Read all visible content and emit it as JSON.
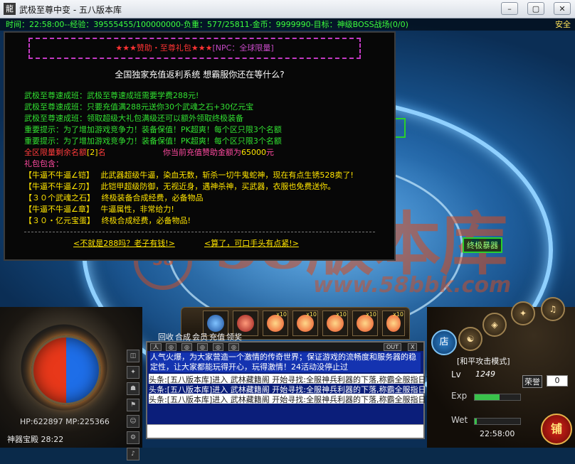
{
  "window": {
    "title": "武极至尊中变 - 五八版本库",
    "icon_name": "app-icon",
    "buttons": [
      "minimize",
      "maximize",
      "close"
    ]
  },
  "hud_top": {
    "status_line": "时间：22:58:00--经验：39555455/100000000-负重：577/25811-金币：9999990-目标：神级BOSS战场(0/0)",
    "safe_zone": "安全"
  },
  "dialog": {
    "banner_red_a": "★★★赞助・至尊礼包★★★",
    "banner_purple": "[NPC：全球限量]",
    "headline": "全国独家充值返利系统 想霸服你还在等什么?",
    "lines": [
      {
        "text": "武极至尊速成班：武极至尊速成班需要学费288元!",
        "color": "green"
      },
      {
        "text": "武极至尊速成班：只要充值满288元送你30个武魂之石+30亿元宝",
        "color": "green"
      },
      {
        "text": "武极至尊速成班：领取超级大礼包满级还可以额外领取终极装备",
        "color": "green"
      },
      {
        "text": "重要提示：为了增加游戏竞争力！装备保值！PK超爽！每个区只限3个名额",
        "color": "green"
      },
      {
        "text": "重要提示：为了增加游戏竞争力！装备保值！PK超爽！每个区只限3个名额",
        "color": "green"
      }
    ],
    "quota_label": "全区限量剩余名额",
    "quota_value": "[2]",
    "quota_unit": "名",
    "sponsor_label": "你当前充值赞助金额为",
    "sponsor_value": "65000",
    "sponsor_unit": "元",
    "gift_heading": "礼包包含：",
    "gifts": [
      {
        "name": "【牛逼不牛逼∠铠】",
        "desc": "此武器超级牛逼，染血无数，斩杀一切牛鬼蛇神，现在有点生锈528卖了!"
      },
      {
        "name": "【牛逼不牛逼∠刃】",
        "desc": "此铠甲超级防御，无视近身，遇神杀神，买武器，衣服也免费送你。"
      },
      {
        "name": "【３０个武魂之石】",
        "desc": "终极装备合成经费，必备物品"
      },
      {
        "name": "【牛逼不牛逼∠章】",
        "desc": "牛逼属性，非常给力!"
      },
      {
        "name": "【３０・亿元宝蛋】",
        "desc": "终极合成经费，必备物品!"
      }
    ],
    "option_left": "<不就是288吗？老子有钱!>",
    "option_right": "<算了，可口手头有点紧!>"
  },
  "scene": {
    "watermark_text": "58版本库",
    "watermark_url": "www.58bbk.com",
    "watermark_logo": "58",
    "map_tag": "终极暴器"
  },
  "hud_bottom": {
    "hp_mp": "HP:622897  MP:225366",
    "map_name": "神器宝殿  28:22",
    "side_icons": [
      "bag-icon",
      "skill-icon",
      "team-icon",
      "guild-icon",
      "friend-icon",
      "setting-icon",
      "sound-icon"
    ],
    "belt_slots": [
      {
        "icon": "rune-skill-icon",
        "color": "#2f72c8",
        "count": ""
      },
      {
        "icon": "flame-skill-icon",
        "color": "#c8322f",
        "count": ""
      },
      {
        "icon": "peach-potion-icon",
        "color": "#ff8a3a",
        "count": "x10"
      },
      {
        "icon": "peach-potion-icon",
        "color": "#ff8a3a",
        "count": "x10"
      },
      {
        "icon": "peach-potion-icon",
        "color": "#ff8a3a",
        "count": "x10"
      },
      {
        "icon": "peach-potion-icon",
        "color": "#ff8a3a",
        "count": "x10"
      },
      {
        "icon": "peach-potion-icon",
        "color": "#ff8a3a",
        "count": "x10"
      }
    ],
    "tabs": [
      "回收",
      "合成",
      "会员",
      "充值",
      "领奖"
    ],
    "chat_controls": [
      "OUT",
      "X"
    ],
    "chat_notice": "人气火爆，为大家营造一个激情的传奇世界；保证游戏的流畅度和服务器的稳定性，让大家都能玩得开心，玩得激情！24活动没停止过",
    "chat_rows": [
      "头条:[五八版本库]进入   武林藏籍阁   开始寻找:全服神兵利器的下落,称霸全服指日可待!",
      "头条:[五八版本库]进入   武林藏籍阁   开始寻找:全服神兵利器的下落,称霸全服指日可待!",
      "头条:[五八版本库]进入   武林藏籍阁   开始寻找:全服神兵利器的下落,称霸全服指日可待!"
    ],
    "mode": "[和平攻击模式]",
    "lv_label": "Lv",
    "lv_value": "1249",
    "honor_label": "荣誉",
    "honor_value": "0",
    "exp_label": "Exp",
    "exp_fill": 0.55,
    "wet_label": "Wet",
    "wet_fill": 0.05,
    "time": "22:58:00",
    "shop_label": "店",
    "store_label": "铺"
  }
}
